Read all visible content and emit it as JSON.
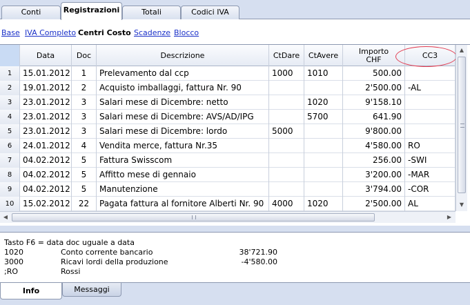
{
  "top_tabs": [
    "Conti",
    "Registrazioni",
    "Totali",
    "Codici IVA"
  ],
  "sub_tabs": [
    "Base",
    "IVA Completo",
    "Centri Costo",
    "Scadenze",
    "Blocco"
  ],
  "table": {
    "headers": {
      "date": "Data",
      "doc": "Doc",
      "desc": "Descrizione",
      "ctdare": "CtDare",
      "ctavere": "CtAvere",
      "importo_l1": "Importo",
      "importo_l2": "CHF",
      "cc3": "CC3"
    },
    "rows": [
      {
        "n": "1",
        "date": "15.01.2012",
        "doc": "1",
        "desc": "Prelevamento dal ccp",
        "cd": "1000",
        "ca": "1010",
        "imp": "500.00",
        "cc3": ""
      },
      {
        "n": "2",
        "date": "19.01.2012",
        "doc": "2",
        "desc": "Acquisto imballaggi, fattura Nr. 90",
        "cd": "",
        "ca": "",
        "imp": "2'500.00",
        "cc3": "-AL"
      },
      {
        "n": "3",
        "date": "23.01.2012",
        "doc": "3",
        "desc": "Salari mese di Dicembre: netto",
        "cd": "",
        "ca": "1020",
        "imp": "9'158.10",
        "cc3": ""
      },
      {
        "n": "4",
        "date": "23.01.2012",
        "doc": "3",
        "desc": "Salari mese di Dicembre: AVS/AD/IPG",
        "cd": "",
        "ca": "5700",
        "imp": "641.90",
        "cc3": ""
      },
      {
        "n": "5",
        "date": "23.01.2012",
        "doc": "3",
        "desc": "Salari mese di Dicembre: lordo",
        "cd": "5000",
        "ca": "",
        "imp": "9'800.00",
        "cc3": ""
      },
      {
        "n": "6",
        "date": "24.01.2012",
        "doc": "4",
        "desc": "Vendita merce, fattura Nr.35",
        "cd": "",
        "ca": "",
        "imp": "4'580.00",
        "cc3": "RO"
      },
      {
        "n": "7",
        "date": "04.02.2012",
        "doc": "5",
        "desc": "Fattura Swisscom",
        "cd": "",
        "ca": "",
        "imp": "256.00",
        "cc3": "-SWI"
      },
      {
        "n": "8",
        "date": "04.02.2012",
        "doc": "5",
        "desc": "Affitto mese di gennaio",
        "cd": "",
        "ca": "",
        "imp": "3'200.00",
        "cc3": "-MAR"
      },
      {
        "n": "9",
        "date": "04.02.2012",
        "doc": "5",
        "desc": "Manutenzione",
        "cd": "",
        "ca": "",
        "imp": "3'794.00",
        "cc3": "-COR"
      },
      {
        "n": "10",
        "date": "15.02.2012",
        "doc": "22",
        "desc": "Pagata fattura al fornitore Alberti Nr. 90",
        "cd": "4000",
        "ca": "1020",
        "imp": "2'500.00",
        "cc3": "AL"
      }
    ]
  },
  "info": {
    "hint": "Tasto F6 = data doc uguale a data",
    "lines": [
      {
        "account": "1020",
        "name": "Conto corrente bancario",
        "amount": "38'721.90"
      },
      {
        "account": "3000",
        "name": "Ricavi lordi della produzione",
        "amount": "-4'580.00"
      },
      {
        "account": ";RO",
        "name": "Rossi",
        "amount": ""
      }
    ]
  },
  "bottom_tabs": [
    "Info",
    "Messaggi"
  ],
  "icons": {
    "scroll_up": "▲",
    "scroll_down": "▼",
    "scroll_left": "◀",
    "scroll_right": "▶",
    "hgrip": "III",
    "vgrip": "≡"
  },
  "colors": {
    "highlight": "#e23b50",
    "link": "#1a30c8"
  }
}
